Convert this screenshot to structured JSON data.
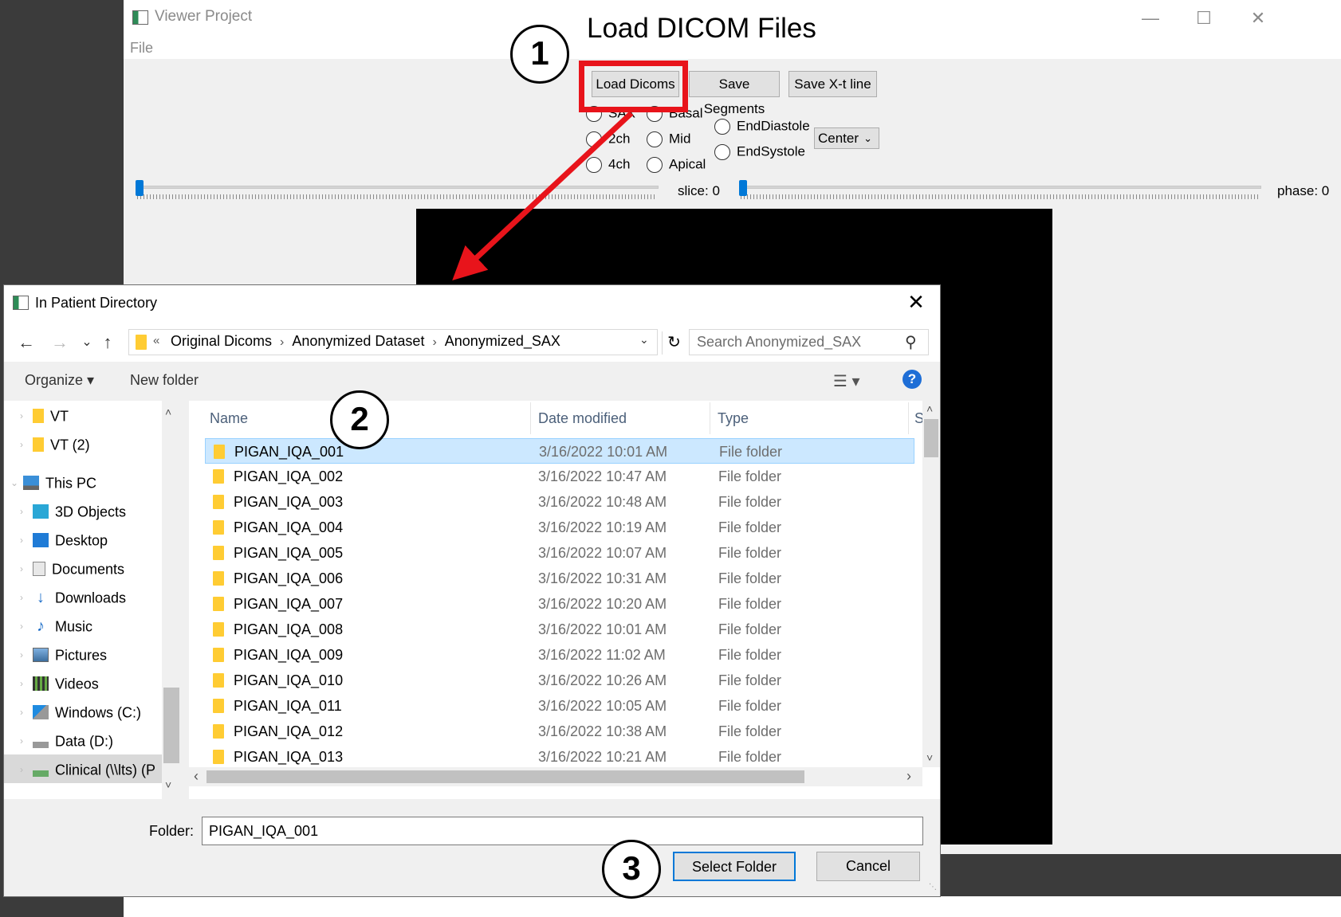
{
  "app": {
    "title": "Viewer Project",
    "menu_file": "File",
    "minimize": "—",
    "maximize": "☐",
    "close": "✕"
  },
  "annotation": {
    "title": "Load DICOM Files",
    "step1": "1",
    "step2": "2",
    "step3": "3",
    "highlight_color": "#e8141b"
  },
  "toolbar": {
    "load_dicoms": "Load Dicoms",
    "save_segments": "Save Segments",
    "save_xt_line": "Save X-t line"
  },
  "view_options": {
    "col1": [
      "SAX",
      "2ch",
      "4ch"
    ],
    "col2": [
      "Basal",
      "Mid",
      "Apical"
    ],
    "col3": [
      "EndDiastole",
      "EndSystole"
    ],
    "combo_value": "Center"
  },
  "sliders": {
    "slice_label": "slice: 0",
    "phase_label": "phase: 0",
    "slice_value": 0,
    "phase_value": 0
  },
  "dialog": {
    "title": "In Patient Directory",
    "close": "✕",
    "nav": {
      "back": "←",
      "forward": "→",
      "recent": "⌄",
      "up": "↑"
    },
    "address": {
      "overflow": "«",
      "crumbs": [
        "Original Dicoms",
        "Anonymized Dataset",
        "Anonymized_SAX"
      ],
      "refresh": "↻"
    },
    "search_placeholder": "Search Anonymized_SAX",
    "organize": "Organize ▾",
    "new_folder": "New folder",
    "help": "?",
    "tree": [
      {
        "label": "VT",
        "icon": "folder-icon"
      },
      {
        "label": "VT (2)",
        "icon": "folder-icon"
      },
      {
        "label": "This PC",
        "icon": "computer-icon"
      },
      {
        "label": "3D Objects",
        "icon": "cube-icon"
      },
      {
        "label": "Desktop",
        "icon": "desktop-icon"
      },
      {
        "label": "Documents",
        "icon": "documents-icon"
      },
      {
        "label": "Downloads",
        "icon": "download-icon"
      },
      {
        "label": "Music",
        "icon": "music-icon"
      },
      {
        "label": "Pictures",
        "icon": "pictures-icon"
      },
      {
        "label": "Videos",
        "icon": "videos-icon"
      },
      {
        "label": "Windows (C:)",
        "icon": "drive-icon"
      },
      {
        "label": "Data (D:)",
        "icon": "drive-icon"
      },
      {
        "label": "Clinical (\\\\lts) (P",
        "icon": "network-drive-icon"
      }
    ],
    "columns": {
      "name": "Name",
      "date": "Date modified",
      "type": "Type",
      "size": "S"
    },
    "files": [
      {
        "name": "PIGAN_IQA_001",
        "date": "3/16/2022 10:01 AM",
        "type": "File folder"
      },
      {
        "name": "PIGAN_IQA_002",
        "date": "3/16/2022 10:47 AM",
        "type": "File folder"
      },
      {
        "name": "PIGAN_IQA_003",
        "date": "3/16/2022 10:48 AM",
        "type": "File folder"
      },
      {
        "name": "PIGAN_IQA_004",
        "date": "3/16/2022 10:19 AM",
        "type": "File folder"
      },
      {
        "name": "PIGAN_IQA_005",
        "date": "3/16/2022 10:07 AM",
        "type": "File folder"
      },
      {
        "name": "PIGAN_IQA_006",
        "date": "3/16/2022 10:31 AM",
        "type": "File folder"
      },
      {
        "name": "PIGAN_IQA_007",
        "date": "3/16/2022 10:20 AM",
        "type": "File folder"
      },
      {
        "name": "PIGAN_IQA_008",
        "date": "3/16/2022 10:01 AM",
        "type": "File folder"
      },
      {
        "name": "PIGAN_IQA_009",
        "date": "3/16/2022 11:02 AM",
        "type": "File folder"
      },
      {
        "name": "PIGAN_IQA_010",
        "date": "3/16/2022 10:26 AM",
        "type": "File folder"
      },
      {
        "name": "PIGAN_IQA_011",
        "date": "3/16/2022 10:05 AM",
        "type": "File folder"
      },
      {
        "name": "PIGAN_IQA_012",
        "date": "3/16/2022 10:38 AM",
        "type": "File folder"
      },
      {
        "name": "PIGAN_IQA_013",
        "date": "3/16/2022 10:21 AM",
        "type": "File folder"
      }
    ],
    "folder_label": "Folder:",
    "folder_value": "PIGAN_IQA_001",
    "select_folder": "Select Folder",
    "cancel": "Cancel"
  }
}
